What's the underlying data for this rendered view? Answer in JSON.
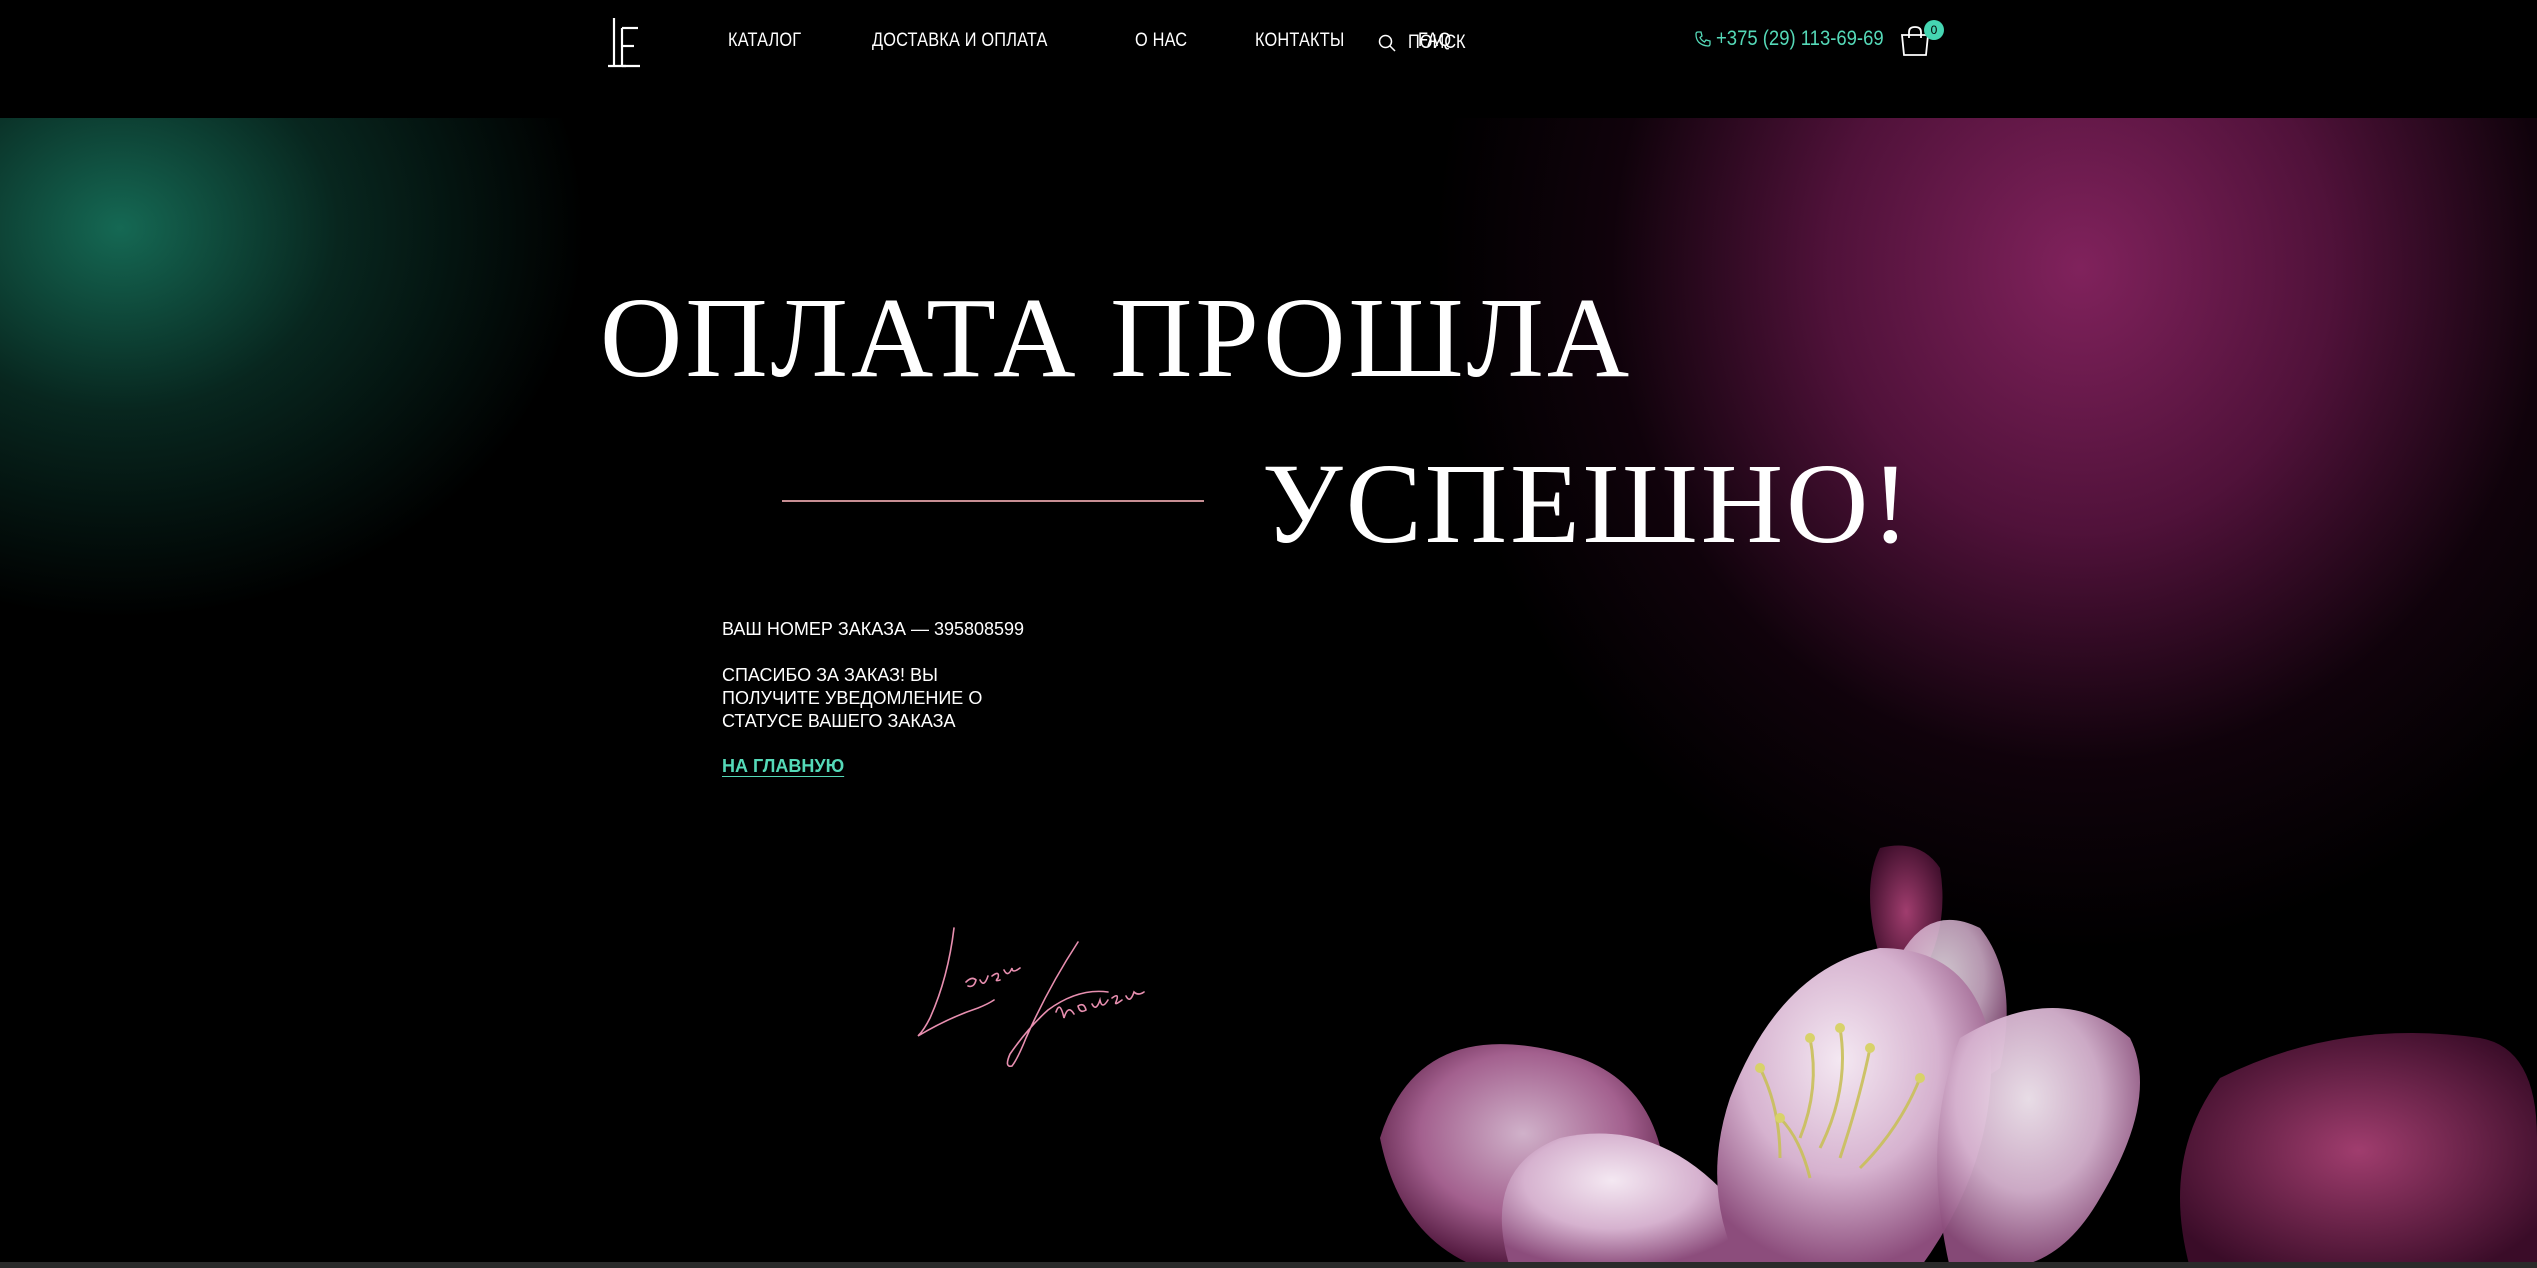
{
  "header": {
    "logo_text": "LE",
    "nav": [
      {
        "label": "КАТАЛОГ"
      },
      {
        "label": "ДОСТАВКА И ОПЛАТА"
      },
      {
        "label": "О НАС"
      },
      {
        "label": "КОНТАКТЫ"
      },
      {
        "label": "FAQ"
      }
    ],
    "search_label": "ПОИСК",
    "search_icon": "search-icon",
    "phone": "+375 (29) 113-69-69",
    "phone_icon": "phone-icon",
    "cart_icon": "shopping-bag-icon",
    "cart_count": "0"
  },
  "hero": {
    "title_line1": "ОПЛАТА ПРОШЛА",
    "title_line2": "УСПЕШНО!",
    "order_number": "ВАШ НОМЕР ЗАКАЗА — 395808599",
    "thanks_text": "СПАСИБО ЗА ЗАКАЗ! ВЫ ПОЛУЧИТЕ УВЕДОМЛЕНИЕ О СТАТУСЕ ВАШЕГО ЗАКАЗА",
    "home_link": "НА ГЛАВНУЮ",
    "signature_text": "Lover Flower"
  },
  "colors": {
    "accent": "#55d9b8",
    "background": "#000000",
    "magenta_glow": "#80225c",
    "green_glow": "#166e58",
    "divider": "#c78e93"
  }
}
